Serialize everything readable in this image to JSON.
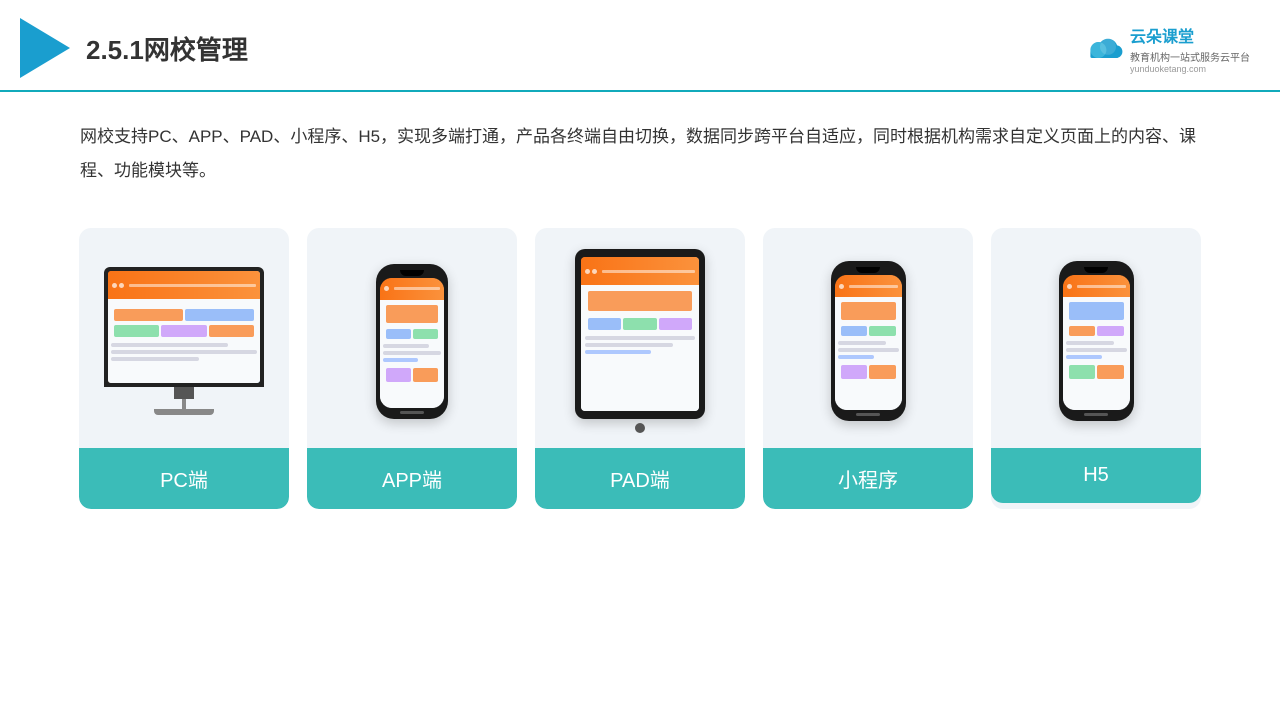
{
  "header": {
    "title": "2.5.1网校管理",
    "brand": {
      "name": "云朵课堂",
      "url": "yunduoketang.com",
      "tagline": "教育机构一站式服务云平台"
    }
  },
  "description": "网校支持PC、APP、PAD、小程序、H5，实现多端打通，产品各终端自由切换，数据同步跨平台自适应，同时根据机构需求自定义页面上的内容、课程、功能模块等。",
  "cards": [
    {
      "label": "PC端",
      "type": "pc"
    },
    {
      "label": "APP端",
      "type": "phone"
    },
    {
      "label": "PAD端",
      "type": "tablet"
    },
    {
      "label": "小程序",
      "type": "phone"
    },
    {
      "label": "H5",
      "type": "phone"
    }
  ],
  "colors": {
    "accent": "#3bbcb8",
    "header_border": "#1ab",
    "triangle": "#1a9ecf"
  }
}
